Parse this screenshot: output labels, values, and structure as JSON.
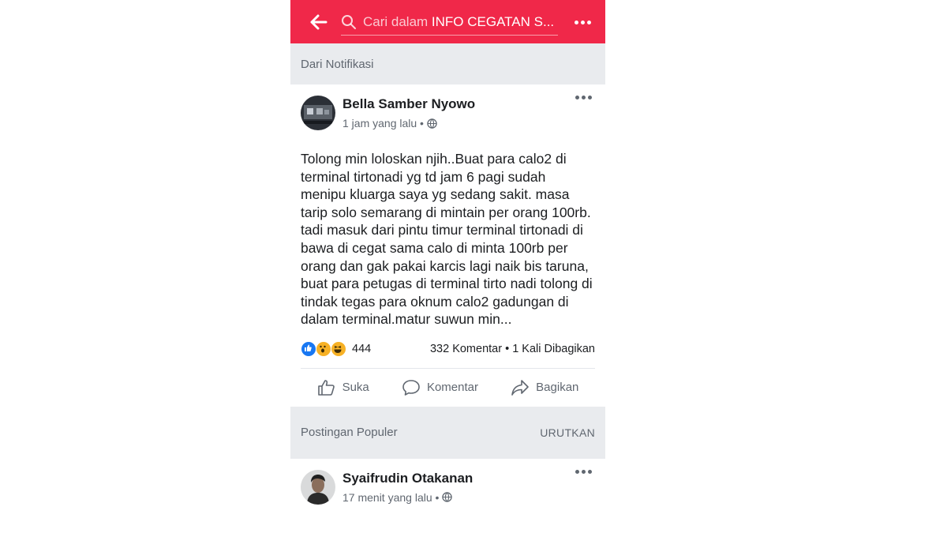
{
  "header": {
    "search_prefix": "Cari dalam ",
    "search_group": "INFO CEGATAN S...",
    "colors": {
      "bar": "#f02849"
    }
  },
  "section_notif": {
    "label": "Dari Notifikasi"
  },
  "post": {
    "author": "Bella Samber Nyowo",
    "time": "1 jam yang lalu •",
    "text": "Tolong min loloskan njih..Buat para calo2 di terminal tirtonadi yg td jam 6 pagi sudah menipu kluarga saya yg sedang sakit. masa tarip solo semarang di mintain per orang 100rb. tadi masuk dari pintu timur terminal tirtonadi di bawa di cegat sama calo di minta 100rb per orang dan gak pakai karcis lagi naik bis taruna, buat para petugas di terminal tirto nadi tolong di tindak tegas para oknum calo2 gadungan di dalam terminal.matur suwun min...",
    "reactions_count": "444",
    "comments": "332 Komentar",
    "shares": "1 Kali Dibagikan",
    "separator": "•",
    "actions": {
      "like": "Suka",
      "comment": "Komentar",
      "share": "Bagikan"
    }
  },
  "section_popular": {
    "label": "Postingan Populer",
    "sort": "URUTKAN"
  },
  "post2": {
    "author": "Syaifrudin Otakanan",
    "time": "17 menit yang lalu •"
  },
  "icons": [
    "back-arrow-icon",
    "search-icon",
    "more-icon",
    "globe-icon",
    "like-reaction-icon",
    "wow-reaction-icon",
    "haha-reaction-icon",
    "thumbs-up-icon",
    "comment-icon",
    "share-icon"
  ]
}
